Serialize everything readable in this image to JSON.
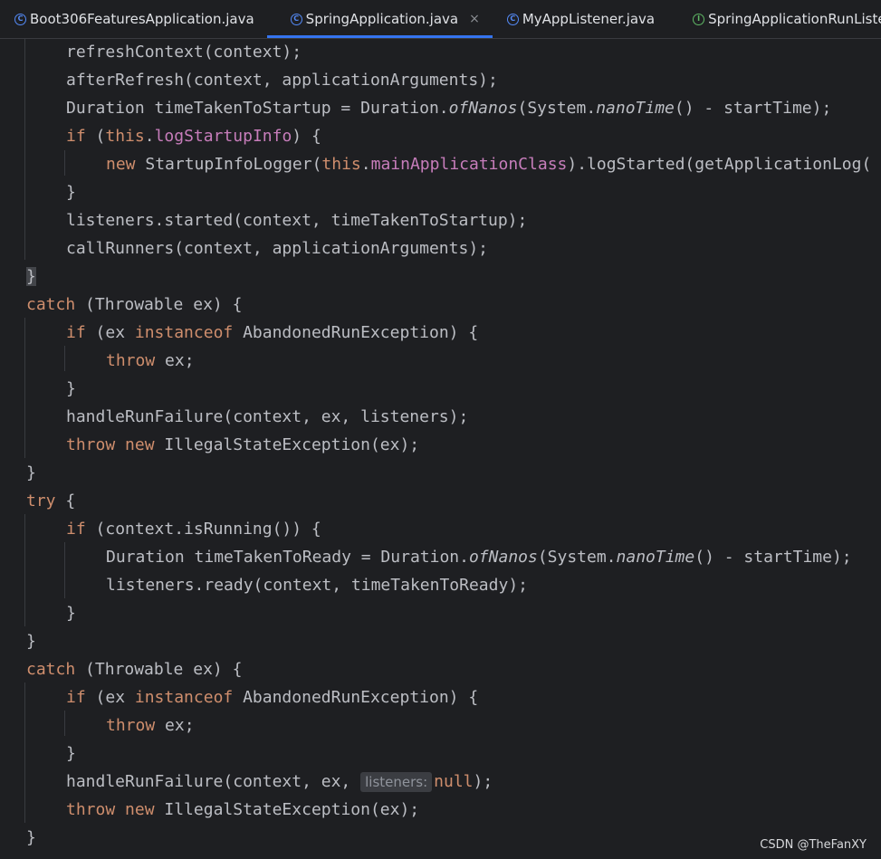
{
  "tabs": [
    {
      "label": "Boot306FeaturesApplication.java",
      "icon": "spring-boot-class-icon",
      "active": false
    },
    {
      "label": "SpringApplication.java",
      "icon": "class-icon",
      "active": true,
      "close": "×"
    },
    {
      "label": "MyAppListener.java",
      "icon": "class-icon",
      "active": false
    },
    {
      "label": "SpringApplicationRunListener.java",
      "icon": "interface-icon",
      "active": false
    }
  ],
  "code": {
    "l1": {
      "text": "refreshContext(context);"
    },
    "l2": {
      "text": "afterRefresh(context, applicationArguments);"
    },
    "l3": {
      "a": "Duration timeTakenToStartup = Duration.",
      "b": "ofNanos",
      "c": "(System.",
      "d": "nanoTime",
      "e": "() - startTime);"
    },
    "l4": {
      "kw": "if",
      "a": " (",
      "this": "this",
      "dot": ".",
      "field": "logStartupInfo",
      "b": ") {"
    },
    "l5": {
      "kw": "new",
      "a": " StartupInfoLogger(",
      "this": "this",
      "dot": ".",
      "field": "mainApplicationClass",
      "b": ").logStarted(getApplicationLog("
    },
    "l6": {
      "text": "}"
    },
    "l7": {
      "text": "listeners.started(context, timeTakenToStartup);"
    },
    "l8": {
      "text": "callRunners(context, applicationArguments);"
    },
    "l9": {
      "text": "}"
    },
    "l10": {
      "kw": "catch",
      "a": " (Throwable ex) {"
    },
    "l11": {
      "kw": "if",
      "a": " (ex ",
      "kw2": "instanceof",
      "b": " AbandonedRunException) {"
    },
    "l12": {
      "kw": "throw",
      "a": " ex;"
    },
    "l13": {
      "text": "}"
    },
    "l14": {
      "text": "handleRunFailure(context, ex, listeners);"
    },
    "l15": {
      "kw": "throw",
      "sp": " ",
      "kw2": "new",
      "a": " IllegalStateException(ex);"
    },
    "l16": {
      "text": "}"
    },
    "l17": {
      "kw": "try",
      "a": " {"
    },
    "l18": {
      "kw": "if",
      "a": " (context.isRunning()) {"
    },
    "l19": {
      "a": "Duration timeTakenToReady = Duration.",
      "b": "ofNanos",
      "c": "(System.",
      "d": "nanoTime",
      "e": "() - startTime);"
    },
    "l20": {
      "text": "listeners.ready(context, timeTakenToReady);"
    },
    "l21": {
      "text": "}"
    },
    "l22": {
      "text": "}"
    },
    "l23": {
      "kw": "catch",
      "a": " (Throwable ex) {"
    },
    "l24": {
      "kw": "if",
      "a": " (ex ",
      "kw2": "instanceof",
      "b": " AbandonedRunException) {"
    },
    "l25": {
      "kw": "throw",
      "a": " ex;"
    },
    "l26": {
      "text": "}"
    },
    "l27": {
      "a": "handleRunFailure(context, ex, ",
      "hint": "listeners:",
      "kw": "null",
      "b": ");"
    },
    "l28": {
      "kw": "throw",
      "sp": " ",
      "kw2": "new",
      "a": " IllegalStateException(ex);"
    },
    "l29": {
      "text": "}"
    }
  },
  "watermark": "CSDN @TheFanXY",
  "colors": {
    "background": "#1e1f22",
    "text": "#bcbec4",
    "keyword": "#cf8e6d",
    "field": "#c77dbb",
    "active_tab_underline": "#3574f0"
  }
}
